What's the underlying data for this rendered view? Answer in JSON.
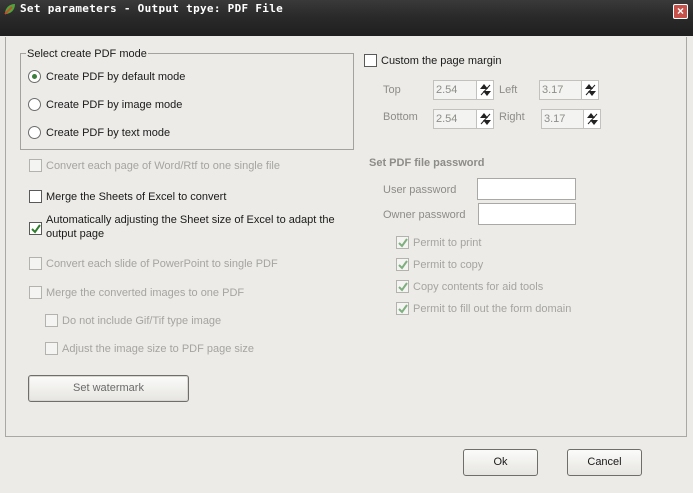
{
  "window": {
    "title": "Set parameters - Output tpye: PDF File",
    "close_icon": "close-icon",
    "app_icon": "leaf-icon"
  },
  "mode_group": {
    "legend": "Select create PDF mode",
    "options": [
      {
        "label": "Create PDF by default mode",
        "selected": true
      },
      {
        "label": "Create PDF by image mode",
        "selected": false
      },
      {
        "label": "Create PDF by text mode",
        "selected": false
      }
    ]
  },
  "left_options": {
    "convert_word": {
      "label": "Convert each page of Word/Rtf to one single file",
      "checked": false,
      "enabled": false
    },
    "merge_excel": {
      "label": "Merge the Sheets of Excel to convert",
      "checked": false,
      "enabled": true
    },
    "adjust_excel": {
      "label": "Automatically adjusting the Sheet size of Excel to adapt the output page",
      "checked": true,
      "enabled": true
    },
    "convert_ppt": {
      "label": "Convert each slide of PowerPoint to single PDF",
      "checked": false,
      "enabled": false
    },
    "merge_images": {
      "label": "Merge the converted images to one PDF",
      "checked": false,
      "enabled": false
    },
    "no_gif_tif": {
      "label": "Do not include Gif/Tif type image",
      "checked": false,
      "enabled": false
    },
    "adjust_image_size": {
      "label": "Adjust the image size to PDF page size",
      "checked": false,
      "enabled": false
    },
    "watermark_button": "Set watermark"
  },
  "margin": {
    "custom_label": "Custom the page margin",
    "checked": false,
    "top_label": "Top",
    "top_value": "2.54",
    "left_label": "Left",
    "left_value": "3.17",
    "bottom_label": "Bottom",
    "bottom_value": "2.54",
    "right_label": "Right",
    "right_value": "3.17"
  },
  "password": {
    "heading": "Set PDF file password",
    "user_label": "User password",
    "user_value": "",
    "owner_label": "Owner password",
    "owner_value": "",
    "permissions": [
      {
        "label": "Permit to print",
        "checked": true
      },
      {
        "label": "Permit to copy",
        "checked": true
      },
      {
        "label": "Copy contents for aid tools",
        "checked": true
      },
      {
        "label": "Permit to fill out the form domain",
        "checked": true
      }
    ]
  },
  "footer": {
    "ok": "Ok",
    "cancel": "Cancel"
  },
  "colors": {
    "title_bar": "#2a2a2a",
    "dialog_bg": "#ecebe7",
    "check_green": "#2f7d2f",
    "close_red": "#c6504a"
  }
}
